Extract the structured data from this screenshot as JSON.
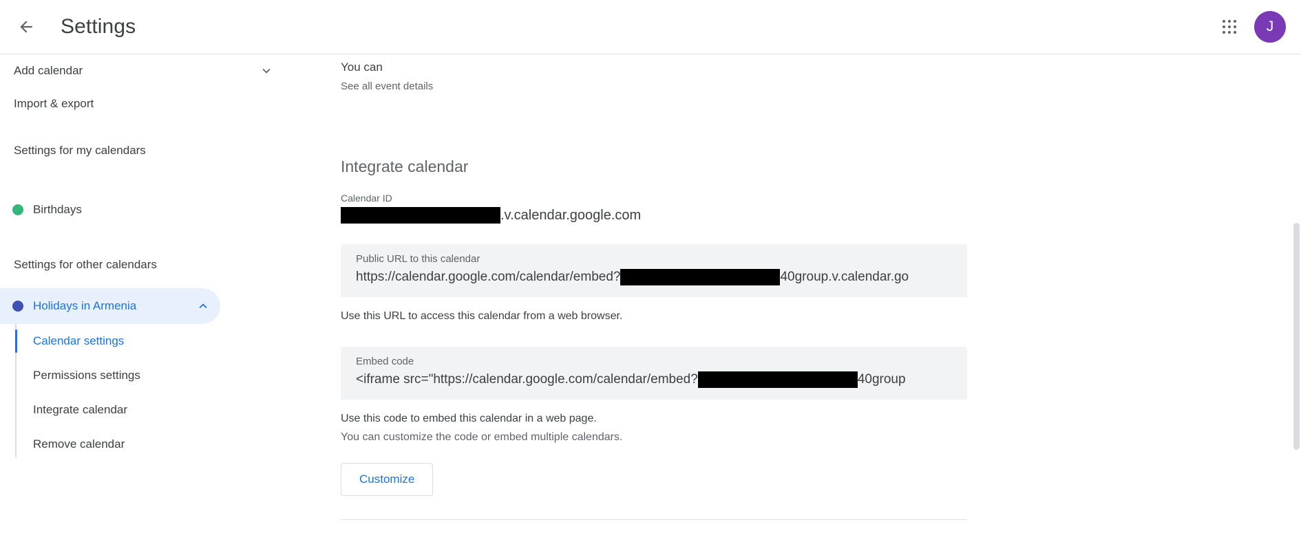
{
  "header": {
    "title": "Settings",
    "back_icon": "arrow-left-icon",
    "apps_icon": "apps-grid-icon",
    "avatar_initial": "J",
    "avatar_color": "#7b3ab5"
  },
  "sidebar": {
    "add_calendar": {
      "label": "Add calendar",
      "icon": "chevron-down-icon"
    },
    "import_export": {
      "label": "Import & export"
    },
    "my_calendars_heading": "Settings for my calendars",
    "my_calendars": [
      {
        "label": "Birthdays",
        "color": "#33b679"
      }
    ],
    "other_calendars_heading": "Settings for other calendars",
    "other_calendars": [
      {
        "label": "Holidays in Armenia",
        "color": "#3f51b5",
        "expanded": true,
        "icon": "chevron-up-icon",
        "sub_items": [
          {
            "label": "Calendar settings",
            "active": true
          },
          {
            "label": "Permissions settings",
            "active": false
          },
          {
            "label": "Integrate calendar",
            "active": false
          },
          {
            "label": "Remove calendar",
            "active": false
          }
        ]
      }
    ]
  },
  "main": {
    "top_fragment": {
      "title": "You can",
      "subtitle": "See all event details"
    },
    "integrate_section": {
      "heading": "Integrate calendar",
      "calendar_id": {
        "label": "Calendar ID",
        "redacted_prefix": "███████████████",
        "suffix": ".v.calendar.google.com"
      },
      "public_url": {
        "label": "Public URL to this calendar",
        "value_prefix": "https://calendar.google.com/calendar/embed?",
        "value_suffix": "40group.v.calendar.go",
        "helper": "Use this URL to access this calendar from a web browser."
      },
      "embed_code": {
        "label": "Embed code",
        "value_prefix": "<iframe src=\"https://calendar.google.com/calendar/embed?",
        "value_suffix": "40group",
        "helper_1": "Use this code to embed this calendar in a web page.",
        "helper_2": "You can customize the code or embed multiple calendars.",
        "customize_label": "Customize"
      }
    }
  },
  "colors": {
    "accent": "#1a73e8",
    "accent_bg": "#e8f0fe",
    "text_primary": "#3c4043",
    "text_secondary": "#5f6368",
    "field_bg": "#f1f3f4"
  }
}
